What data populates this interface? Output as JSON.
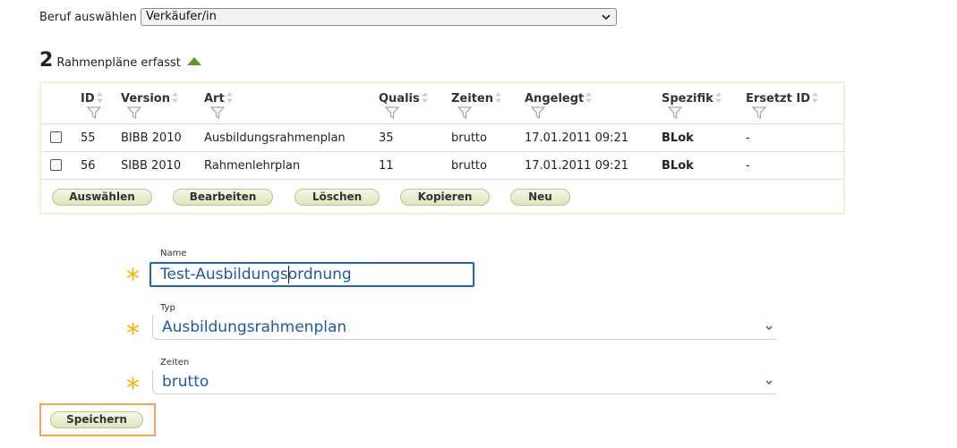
{
  "beruf": {
    "label": "Beruf auswählen",
    "selected": "Verkäufer/in"
  },
  "summary": {
    "count": "2",
    "text": "Rahmenpläne erfasst",
    "icon": "collapse-up-arrow-icon",
    "icon_color": "#5a9a2a"
  },
  "table": {
    "columns": [
      "ID",
      "Version",
      "Art",
      "Qualis",
      "Zeiten",
      "Angelegt",
      "Spezifik",
      "Ersetzt ID"
    ],
    "rows": [
      {
        "id": "55",
        "version": "BIBB 2010",
        "art": "Ausbildungsrahmenplan",
        "qualis": "35",
        "zeiten": "brutto",
        "angelegt": "17.01.2011 09:21",
        "spezifik": "BLok",
        "ersetzt": "-"
      },
      {
        "id": "56",
        "version": "SIBB 2010",
        "art": "Rahmenlehrplan",
        "qualis": "11",
        "zeiten": "brutto",
        "angelegt": "17.01.2011 09:21",
        "spezifik": "BLok",
        "ersetzt": "-"
      }
    ],
    "buttons": [
      "Auswählen",
      "Bearbeiten",
      "Löschen",
      "Kopieren",
      "Neu"
    ]
  },
  "form": {
    "name": {
      "label": "Name",
      "value": "Test-Ausbildungsordnung"
    },
    "typ": {
      "label": "Typ",
      "value": "Ausbildungsrahmenplan"
    },
    "zeiten": {
      "label": "Zeiten",
      "value": "brutto"
    },
    "required_mark": "*",
    "required_color": "#f4b400",
    "save_label": "Speichern"
  },
  "colors": {
    "accent_blue": "#1e66b4",
    "highlight_orange": "#f0a654",
    "panel_border": "#eef3d6"
  }
}
